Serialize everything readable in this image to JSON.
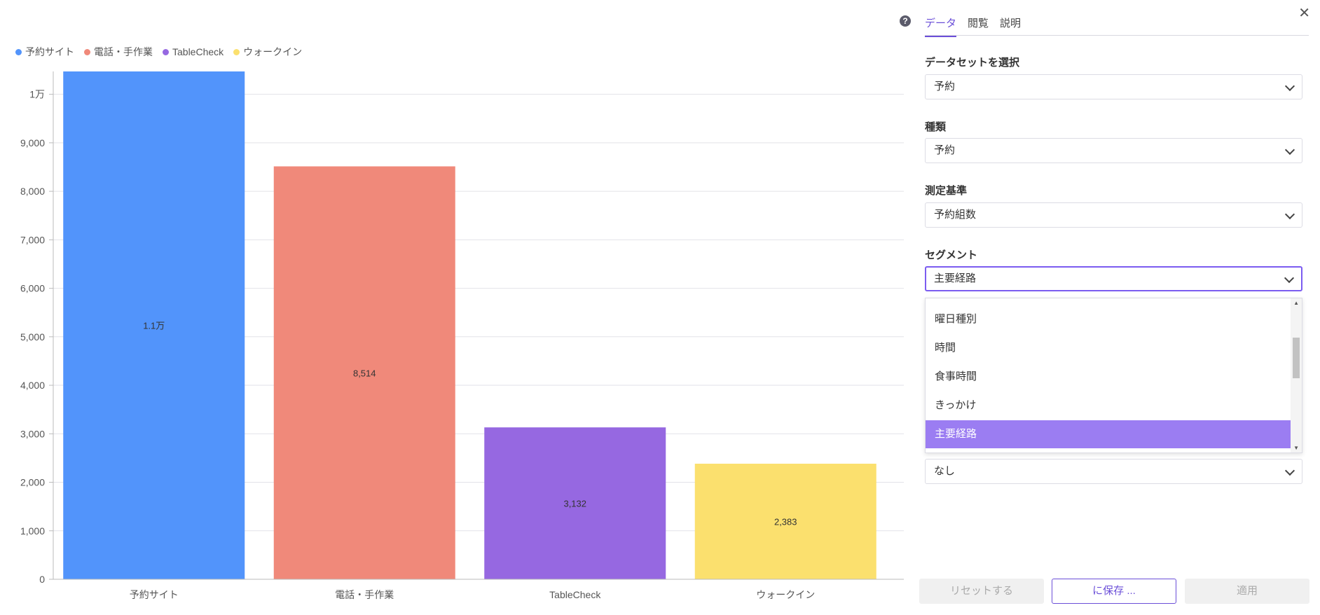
{
  "chart_data": {
    "type": "bar",
    "categories": [
      "予約サイト",
      "電話・手作業",
      "TableCheck",
      "ウォークイン"
    ],
    "values": [
      11000,
      8514,
      3132,
      2383
    ],
    "data_labels": [
      "1.1万",
      "8,514",
      "3,132",
      "2,383"
    ],
    "colors": [
      "#5294fb",
      "#f0897a",
      "#9668e1",
      "#fbe06e"
    ],
    "y_ticks": [
      0,
      1000,
      2000,
      3000,
      4000,
      5000,
      6000,
      7000,
      8000,
      9000,
      10000
    ],
    "y_tick_labels": [
      "0",
      "1,000",
      "2,000",
      "3,000",
      "4,000",
      "5,000",
      "6,000",
      "7,000",
      "8,000",
      "9,000",
      "1万"
    ],
    "ylim": [
      0,
      10500
    ],
    "grid": true,
    "legend": "top-left",
    "title": "",
    "xlabel": "",
    "ylabel": ""
  },
  "panel": {
    "tabs": [
      "データ",
      "閲覧",
      "説明"
    ],
    "active_tab": 0,
    "dataset": {
      "label": "データセットを選択",
      "value": "予約"
    },
    "kind": {
      "label": "種類",
      "value": "予約"
    },
    "measure": {
      "label": "測定基準",
      "value": "予約組数"
    },
    "segment": {
      "label": "セグメント",
      "value": "主要経路"
    },
    "dropdown_options": [
      "曜日種別",
      "時間",
      "食事時間",
      "きっかけ",
      "主要経路"
    ],
    "dropdown_selected": 4,
    "hidden_field_value": "なし",
    "buttons": {
      "reset": "リセットする",
      "save": "に保存 ...",
      "apply": "適用"
    }
  },
  "icons": {
    "help": "help-icon",
    "close": "close-icon"
  }
}
